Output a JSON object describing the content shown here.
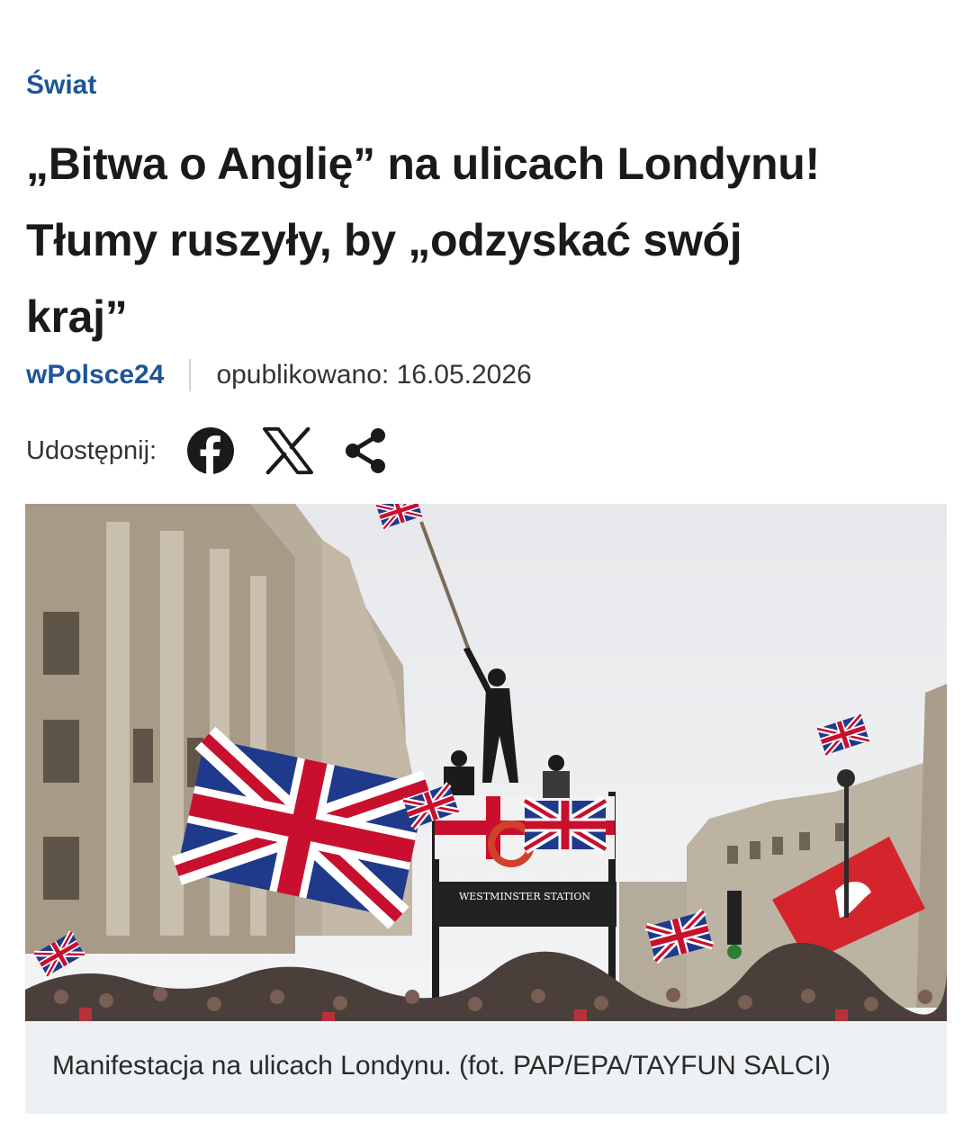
{
  "article": {
    "category": "Świat",
    "title_lines": [
      "„Bitwa o Anglię” na ulicach Londynu!",
      "Tłumy ruszyły, by „odzyskać swój",
      "kraj”"
    ],
    "author": "wPolsce24",
    "published": "opublikowano: 16.05.2026"
  },
  "share": {
    "label": "Udostępnij:",
    "buttons": [
      {
        "icon": "facebook-icon"
      },
      {
        "icon": "x-icon"
      },
      {
        "icon": "share-icon"
      }
    ]
  },
  "image": {
    "caption": "Manifestacja na ulicach Londynu. (fot. PAP/EPA/TAYFUN SALCI)",
    "station_sign": "WESTMINSTER STATION"
  },
  "colors": {
    "accent": "#1f5596",
    "text": "#1a1a1a",
    "caption_bg": "#eef1f4"
  }
}
